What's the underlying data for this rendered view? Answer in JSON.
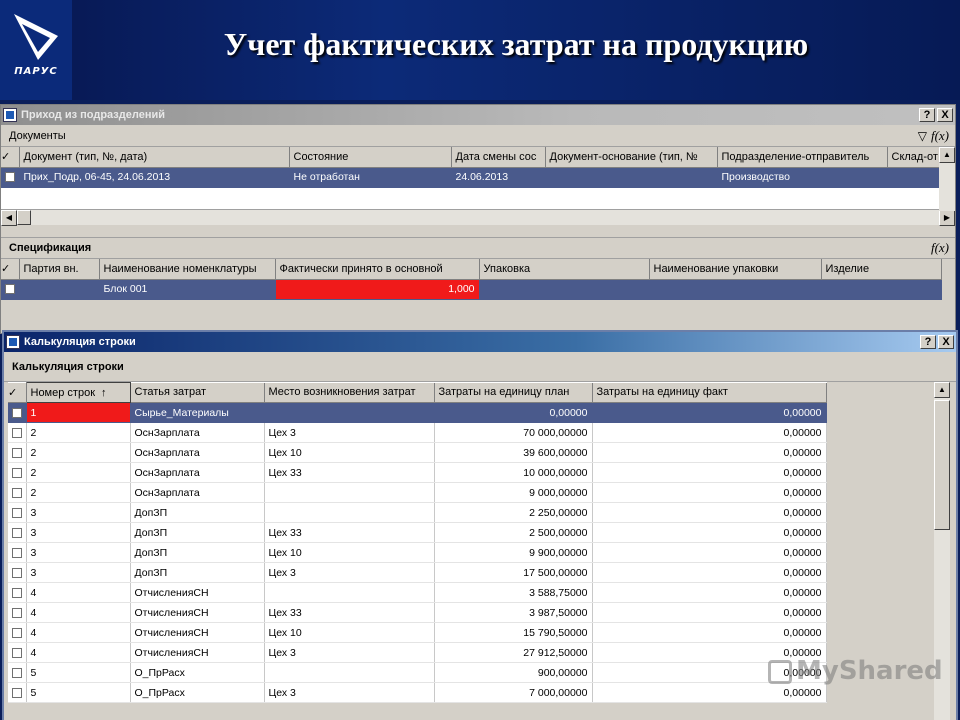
{
  "slide": {
    "title": "Учет фактических затрат на продукцию",
    "logo_text": "ПАРУС"
  },
  "win1": {
    "title": "Приход из подразделений",
    "help_btn": "?",
    "close_btn": "X",
    "documents_label": "Документы",
    "filter_icon": "filter-icon",
    "fx_label": "f(x)",
    "doc_columns": [
      "Документ (тип, №, дата)",
      "Состояние",
      "Дата смены сос",
      "Документ-основание (тип, №",
      "Подразделение-отправитель",
      "Склад-от"
    ],
    "doc_rows": [
      {
        "doc": "Прих_Подр, 06-45, 24.06.2013",
        "state": "Не отработан",
        "date": "24.06.2013",
        "base": "",
        "dept": "Производство",
        "store": ""
      }
    ],
    "spec_label": "Спецификация",
    "spec_columns": [
      "Партия вн.",
      "Наименование номенклатуры",
      "Фактически принято в основной",
      "Упаковка",
      "Наименование упаковки",
      "Изделие"
    ],
    "spec_rows": [
      {
        "batch": "",
        "name": "Блок 001",
        "qty": "1,000",
        "pack": "",
        "pack_name": "",
        "item": ""
      }
    ]
  },
  "win2": {
    "title": "Калькуляция строки",
    "help_btn": "?",
    "close_btn": "X",
    "section_label": "Калькуляция строки",
    "columns": [
      "Номер строк",
      "Статья затрат",
      "Место возникновения затрат",
      "Затраты на единицу план",
      "Затраты на единицу факт"
    ],
    "sort_glyph": "↑",
    "rows": [
      {
        "n": "1",
        "item": "Сырье_Материалы",
        "place": "",
        "plan": "0,00000",
        "fact": "0,00000"
      },
      {
        "n": "2",
        "item": "ОснЗарплата",
        "place": "Цех 3",
        "plan": "70 000,00000",
        "fact": "0,00000"
      },
      {
        "n": "2",
        "item": "ОснЗарплата",
        "place": "Цех 10",
        "plan": "39 600,00000",
        "fact": "0,00000"
      },
      {
        "n": "2",
        "item": "ОснЗарплата",
        "place": "Цех 33",
        "plan": "10 000,00000",
        "fact": "0,00000"
      },
      {
        "n": "2",
        "item": "ОснЗарплата",
        "place": "",
        "plan": "9 000,00000",
        "fact": "0,00000"
      },
      {
        "n": "3",
        "item": "ДопЗП",
        "place": "",
        "plan": "2 250,00000",
        "fact": "0,00000"
      },
      {
        "n": "3",
        "item": "ДопЗП",
        "place": "Цех 33",
        "plan": "2 500,00000",
        "fact": "0,00000"
      },
      {
        "n": "3",
        "item": "ДопЗП",
        "place": "Цех 10",
        "plan": "9 900,00000",
        "fact": "0,00000"
      },
      {
        "n": "3",
        "item": "ДопЗП",
        "place": "Цех 3",
        "plan": "17 500,00000",
        "fact": "0,00000"
      },
      {
        "n": "4",
        "item": "ОтчисленияСН",
        "place": "",
        "plan": "3 588,75000",
        "fact": "0,00000"
      },
      {
        "n": "4",
        "item": "ОтчисленияСН",
        "place": "Цех 33",
        "plan": "3 987,50000",
        "fact": "0,00000"
      },
      {
        "n": "4",
        "item": "ОтчисленияСН",
        "place": "Цех 10",
        "plan": "15 790,50000",
        "fact": "0,00000"
      },
      {
        "n": "4",
        "item": "ОтчисленияСН",
        "place": "Цех 3",
        "plan": "27 912,50000",
        "fact": "0,00000"
      },
      {
        "n": "5",
        "item": "О_ПрРасх",
        "place": "",
        "plan": "900,00000",
        "fact": "0,00000"
      },
      {
        "n": "5",
        "item": "О_ПрРасх",
        "place": "Цех 3",
        "plan": "7 000,00000",
        "fact": "0,00000"
      }
    ]
  },
  "watermark": "MyShared",
  "colors": {
    "selection": "#4a5a8c",
    "highlight": "#f01a1a",
    "slide_bg": "#0a1e5a"
  }
}
